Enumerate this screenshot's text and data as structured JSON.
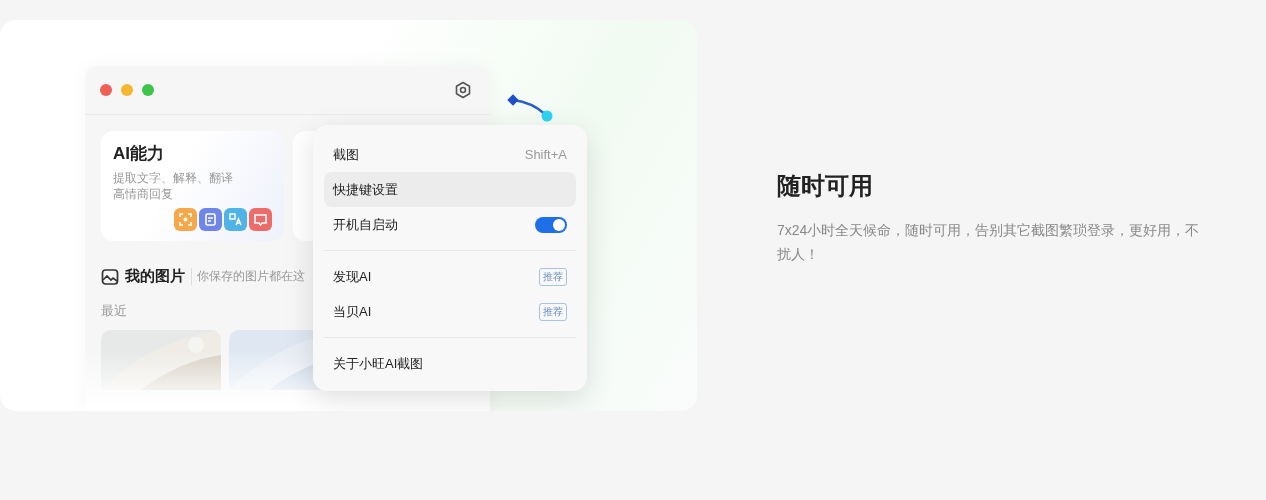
{
  "app_window": {
    "feature_cards": [
      {
        "kind": "text",
        "title": "AI能力",
        "lines": [
          "提取文字、解释、翻译",
          "高情商回复"
        ]
      },
      {
        "kind": "covered"
      }
    ],
    "gallery": {
      "title": "我的图片",
      "subtitle": "你保存的图片都在这",
      "section": "最近"
    }
  },
  "menu": {
    "sections": [
      [
        {
          "kind": "shortcut",
          "label": "截图",
          "shortcut": "Shift+A",
          "selected": false
        },
        {
          "kind": "plain",
          "label": "快捷键设置",
          "selected": true
        },
        {
          "kind": "toggle",
          "label": "开机自启动",
          "on": true,
          "selected": false
        }
      ],
      [
        {
          "kind": "tag",
          "label": "发现AI",
          "tag": "推荐",
          "selected": false
        },
        {
          "kind": "tag",
          "label": "当贝AI",
          "tag": "推荐",
          "selected": false
        }
      ],
      [
        {
          "kind": "plain",
          "label": "关于小旺AI截图",
          "selected": false
        }
      ]
    ]
  },
  "feature": {
    "title": "随时可用",
    "description": "7x24小时全天候命，随时可用，告别其它截图繁琐登录，更好用，不扰人！"
  }
}
